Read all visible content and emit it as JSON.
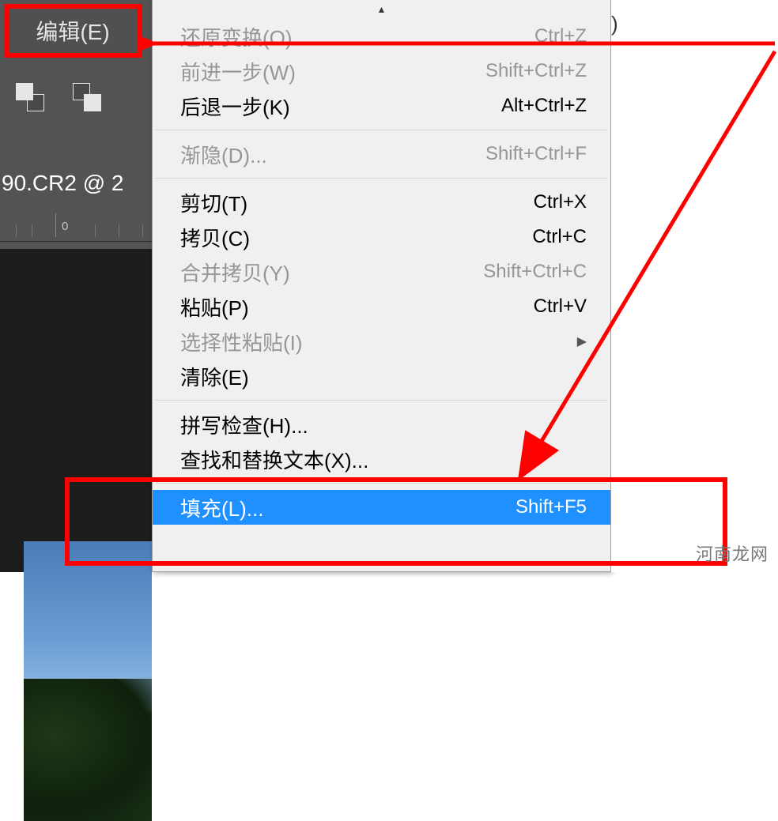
{
  "menu_button": {
    "label": "编辑(E)"
  },
  "tab": {
    "label": "90.CR2 @ 2"
  },
  "ruler": {
    "tick_label": "0"
  },
  "right_stub": ")",
  "watermark": "河南龙网",
  "dropdown": {
    "items": [
      {
        "label": "还原变换(O)",
        "shortcut": "Ctrl+Z",
        "disabled": true
      },
      {
        "label": "前进一步(W)",
        "shortcut": "Shift+Ctrl+Z",
        "disabled": true
      },
      {
        "label": "后退一步(K)",
        "shortcut": "Alt+Ctrl+Z",
        "disabled": false
      },
      {
        "sep": true
      },
      {
        "label": "渐隐(D)...",
        "shortcut": "Shift+Ctrl+F",
        "disabled": true
      },
      {
        "sep": true
      },
      {
        "label": "剪切(T)",
        "shortcut": "Ctrl+X",
        "disabled": false
      },
      {
        "label": "拷贝(C)",
        "shortcut": "Ctrl+C",
        "disabled": false
      },
      {
        "label": "合并拷贝(Y)",
        "shortcut": "Shift+Ctrl+C",
        "disabled": true
      },
      {
        "label": "粘贴(P)",
        "shortcut": "Ctrl+V",
        "disabled": false
      },
      {
        "label": "选择性粘贴(I)",
        "submenu": true,
        "disabled": true
      },
      {
        "label": "清除(E)",
        "shortcut": "",
        "disabled": false
      },
      {
        "sep": true
      },
      {
        "label": "拼写检查(H)...",
        "shortcut": "",
        "disabled": false
      },
      {
        "label": "查找和替换文本(X)...",
        "shortcut": "",
        "disabled": false
      },
      {
        "sep": true
      },
      {
        "label": "填充(L)...",
        "shortcut": "Shift+F5",
        "disabled": false,
        "highlight": true
      }
    ]
  }
}
